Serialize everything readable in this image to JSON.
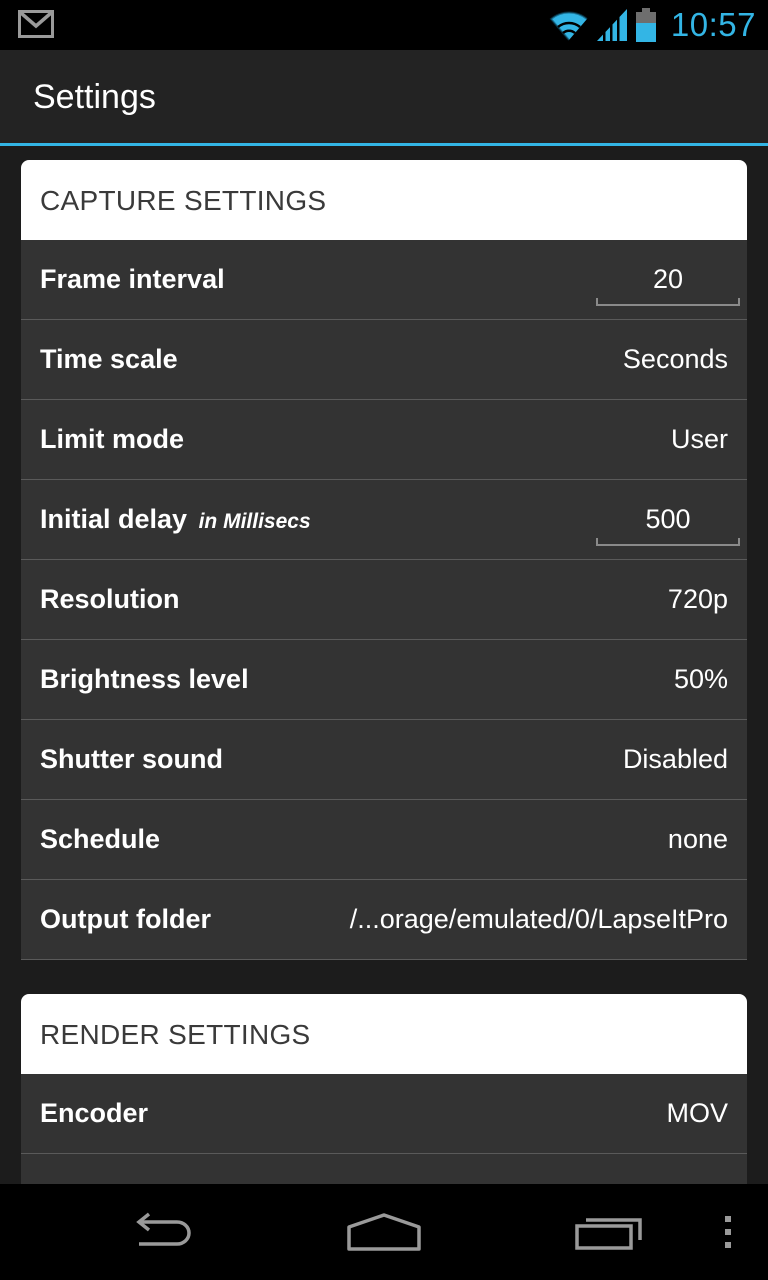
{
  "status_bar": {
    "time": "10:57",
    "icons": [
      "gmail-icon",
      "wifi-icon",
      "signal-icon",
      "battery-icon"
    ],
    "accent_color": "#33b5e5"
  },
  "action_bar": {
    "title": "Settings"
  },
  "capture_settings": {
    "header": "CAPTURE SETTINGS",
    "rows": [
      {
        "label": "Frame interval",
        "value": "20"
      },
      {
        "label": "Time scale",
        "value": "Seconds"
      },
      {
        "label": "Limit mode",
        "value": "User"
      },
      {
        "label": "Initial delay",
        "sublabel": "in Millisecs",
        "value": "500"
      },
      {
        "label": "Resolution",
        "value": "720p"
      },
      {
        "label": "Brightness level",
        "value": "50%"
      },
      {
        "label": "Shutter sound",
        "value": "Disabled"
      },
      {
        "label": "Schedule",
        "value": "none"
      },
      {
        "label": "Output folder",
        "value": "/...orage/emulated/0/LapseItPro"
      }
    ]
  },
  "render_settings": {
    "header": "RENDER SETTINGS",
    "rows": [
      {
        "label": "Encoder",
        "value": "MOV"
      }
    ]
  },
  "nav_bar": {
    "icons": [
      "back-icon",
      "home-icon",
      "recent-apps-icon",
      "overflow-menu-icon"
    ]
  }
}
